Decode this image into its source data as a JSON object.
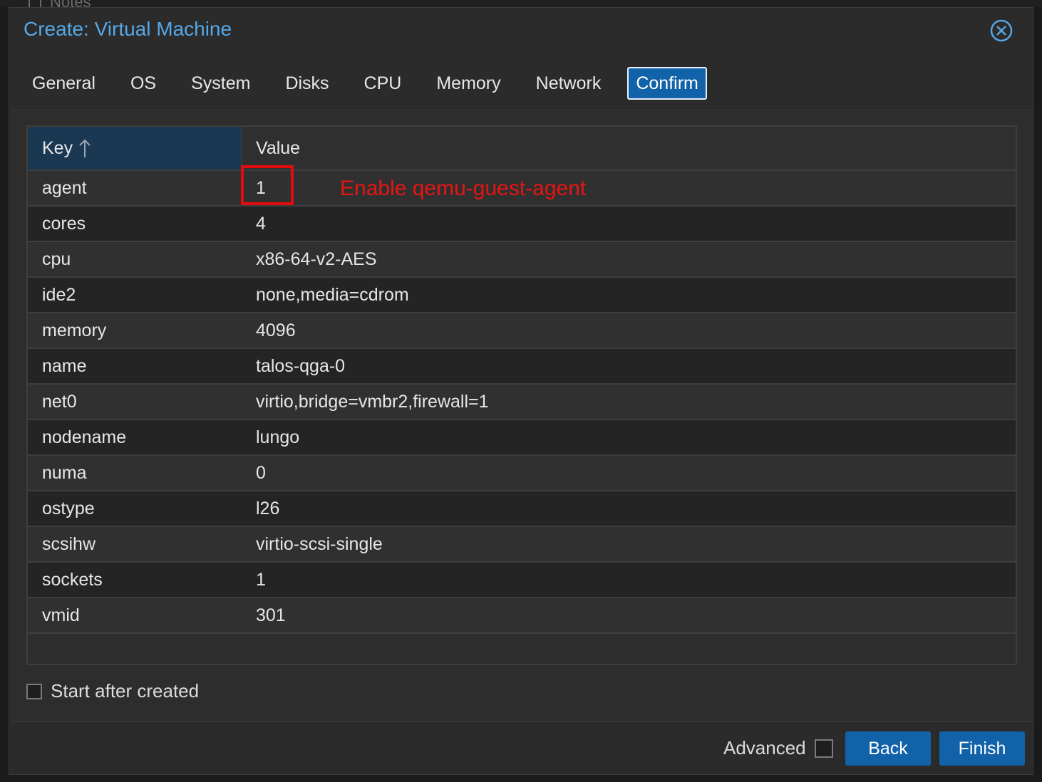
{
  "background": {
    "notes_label": "Notes"
  },
  "dialog": {
    "title": "Create: Virtual Machine",
    "close_icon": "close-circle-icon"
  },
  "tabs": [
    {
      "label": "General",
      "active": false
    },
    {
      "label": "OS",
      "active": false
    },
    {
      "label": "System",
      "active": false
    },
    {
      "label": "Disks",
      "active": false
    },
    {
      "label": "CPU",
      "active": false
    },
    {
      "label": "Memory",
      "active": false
    },
    {
      "label": "Network",
      "active": false
    },
    {
      "label": "Confirm",
      "active": true
    }
  ],
  "grid": {
    "columns": {
      "key": "Key",
      "value": "Value"
    },
    "sort_icon": "arrow-up-icon",
    "rows": [
      {
        "key": "agent",
        "value": "1"
      },
      {
        "key": "cores",
        "value": "4"
      },
      {
        "key": "cpu",
        "value": "x86-64-v2-AES"
      },
      {
        "key": "ide2",
        "value": "none,media=cdrom"
      },
      {
        "key": "memory",
        "value": "4096"
      },
      {
        "key": "name",
        "value": "talos-qga-0"
      },
      {
        "key": "net0",
        "value": "virtio,bridge=vmbr2,firewall=1"
      },
      {
        "key": "nodename",
        "value": "lungo"
      },
      {
        "key": "numa",
        "value": "0"
      },
      {
        "key": "ostype",
        "value": "l26"
      },
      {
        "key": "scsihw",
        "value": "virtio-scsi-single"
      },
      {
        "key": "sockets",
        "value": "1"
      },
      {
        "key": "vmid",
        "value": "301"
      }
    ]
  },
  "annotation": {
    "text": "Enable qemu-guest-agent",
    "color": "#e81414"
  },
  "start_after_created": {
    "label": "Start after created",
    "checked": false
  },
  "footer": {
    "advanced_label": "Advanced",
    "advanced_checked": false,
    "back_label": "Back",
    "finish_label": "Finish"
  },
  "colors": {
    "accent": "#1162a8",
    "title": "#56a7e6",
    "dialog_bg": "#2b2b2b",
    "highlight": "#e30b0b"
  }
}
